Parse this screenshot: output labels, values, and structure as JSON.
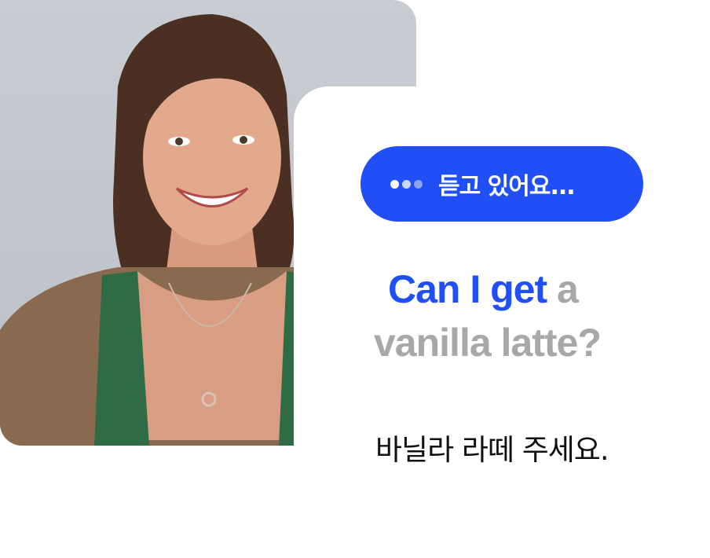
{
  "listening_indicator": {
    "label": "듣고 있어요..."
  },
  "sentence": {
    "line1_spoken": "Can I get",
    "line1_pending": "a",
    "line2_pending": "vanilla latte?"
  },
  "translation": {
    "text": "바닐라 라떼 주세요."
  },
  "colors": {
    "accent": "#1f4ff5",
    "pending_text": "#a8a8a8"
  }
}
